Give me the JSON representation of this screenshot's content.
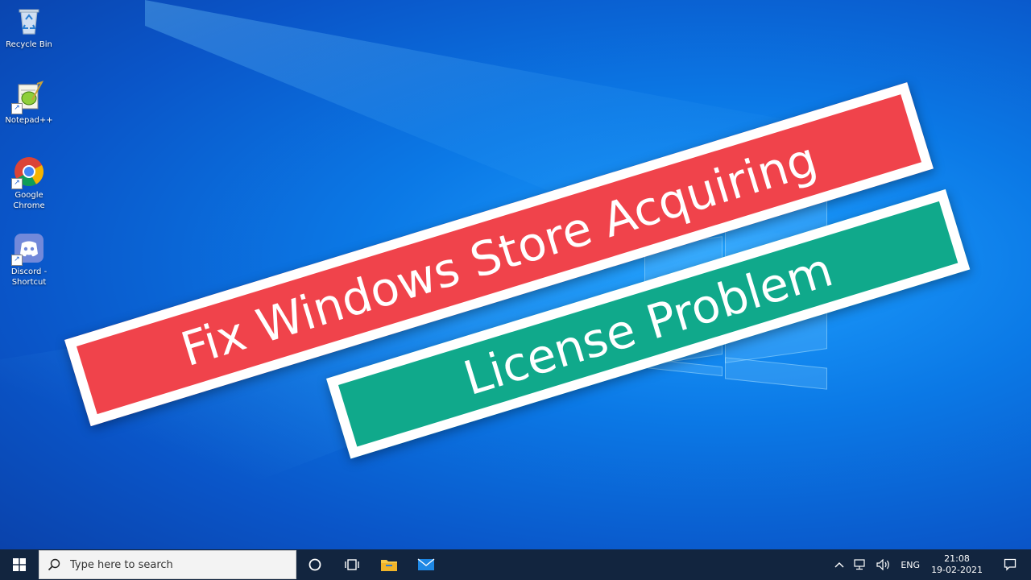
{
  "desktop": {
    "icons": [
      {
        "label": "Recycle Bin",
        "icon": "recycle-bin-icon"
      },
      {
        "label": "Notepad++",
        "icon": "notepad-plus-plus-icon"
      },
      {
        "label": "Google Chrome",
        "icon": "chrome-icon"
      },
      {
        "label": "Discord - Shortcut",
        "icon": "discord-icon"
      }
    ]
  },
  "banners": {
    "line1": "Fix Windows Store Acquiring",
    "line2": "License Problem",
    "line1_color": "#f0434b",
    "line2_color": "#10a98b"
  },
  "taskbar": {
    "search_placeholder": "Type here to search",
    "language": "ENG",
    "time": "21:08",
    "date": "19-02-2021",
    "background": "#12253f"
  }
}
